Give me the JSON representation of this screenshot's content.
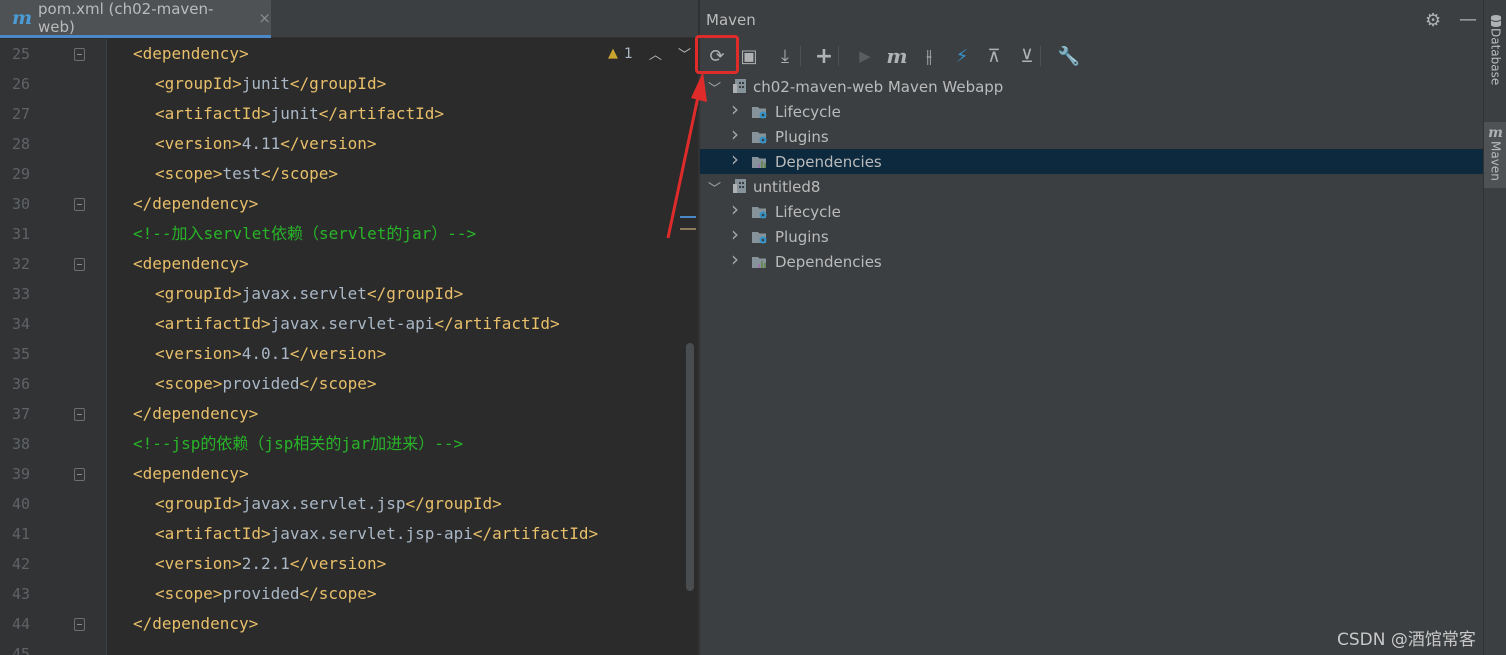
{
  "editor": {
    "tab": {
      "icon": "maven-m-icon",
      "label": "pom.xml (ch02-maven-web)",
      "close": "×"
    },
    "inspection": {
      "icon": "warning-icon",
      "count": "1"
    },
    "lines": [
      {
        "num": "25",
        "indent": 1,
        "parts": [
          {
            "c": "tag",
            "t": "<dependency>"
          }
        ],
        "fold": "start"
      },
      {
        "num": "26",
        "indent": 2,
        "parts": [
          {
            "c": "tag",
            "t": "<groupId>"
          },
          {
            "c": "txt",
            "t": "junit"
          },
          {
            "c": "tag",
            "t": "</groupId>"
          }
        ]
      },
      {
        "num": "27",
        "indent": 2,
        "parts": [
          {
            "c": "tag",
            "t": "<artifactId>"
          },
          {
            "c": "txt",
            "t": "junit"
          },
          {
            "c": "tag",
            "t": "</artifactId>"
          }
        ]
      },
      {
        "num": "28",
        "indent": 2,
        "parts": [
          {
            "c": "tag",
            "t": "<version>"
          },
          {
            "c": "txt",
            "t": "4.11"
          },
          {
            "c": "tag",
            "t": "</version>"
          }
        ]
      },
      {
        "num": "29",
        "indent": 2,
        "parts": [
          {
            "c": "tag",
            "t": "<scope>"
          },
          {
            "c": "txt",
            "t": "test"
          },
          {
            "c": "tag",
            "t": "</scope>"
          }
        ]
      },
      {
        "num": "30",
        "indent": 1,
        "parts": [
          {
            "c": "tag",
            "t": "</dependency>"
          }
        ],
        "fold": "end"
      },
      {
        "num": "31",
        "indent": 1,
        "parts": [
          {
            "c": "cmt",
            "t": "<!--加入servlet依赖（servlet的jar）-->"
          }
        ]
      },
      {
        "num": "32",
        "indent": 1,
        "parts": [
          {
            "c": "tag",
            "t": "<dependency>"
          }
        ],
        "fold": "start"
      },
      {
        "num": "33",
        "indent": 2,
        "parts": [
          {
            "c": "tag",
            "t": "<groupId>"
          },
          {
            "c": "txt",
            "t": "javax.servlet"
          },
          {
            "c": "tag",
            "t": "</groupId>"
          }
        ]
      },
      {
        "num": "34",
        "indent": 2,
        "parts": [
          {
            "c": "tag",
            "t": "<artifactId>"
          },
          {
            "c": "txt",
            "t": "javax.servlet-api"
          },
          {
            "c": "tag",
            "t": "</artifactId>"
          }
        ]
      },
      {
        "num": "35",
        "indent": 2,
        "parts": [
          {
            "c": "tag",
            "t": "<version>"
          },
          {
            "c": "txt",
            "t": "4.0.1"
          },
          {
            "c": "tag",
            "t": "</version>"
          }
        ]
      },
      {
        "num": "36",
        "indent": 2,
        "parts": [
          {
            "c": "tag",
            "t": "<scope>"
          },
          {
            "c": "txt",
            "t": "provided"
          },
          {
            "c": "tag",
            "t": "</scope>"
          }
        ]
      },
      {
        "num": "37",
        "indent": 1,
        "parts": [
          {
            "c": "tag",
            "t": "</dependency>"
          }
        ],
        "fold": "end"
      },
      {
        "num": "38",
        "indent": 1,
        "parts": [
          {
            "c": "cmt",
            "t": "<!--jsp的依赖（jsp相关的jar加进来）-->"
          }
        ]
      },
      {
        "num": "39",
        "indent": 1,
        "parts": [
          {
            "c": "tag",
            "t": "<dependency>"
          }
        ],
        "fold": "start"
      },
      {
        "num": "40",
        "indent": 2,
        "parts": [
          {
            "c": "tag",
            "t": "<groupId>"
          },
          {
            "c": "txt",
            "t": "javax.servlet.jsp"
          },
          {
            "c": "tag",
            "t": "</groupId>"
          }
        ]
      },
      {
        "num": "41",
        "indent": 2,
        "parts": [
          {
            "c": "tag",
            "t": "<artifactId>"
          },
          {
            "c": "txt",
            "t": "javax.servlet.jsp-api"
          },
          {
            "c": "tag",
            "t": "</artifactId>"
          }
        ]
      },
      {
        "num": "42",
        "indent": 2,
        "parts": [
          {
            "c": "tag",
            "t": "<version>"
          },
          {
            "c": "txt",
            "t": "2.2.1"
          },
          {
            "c": "tag",
            "t": "</version>"
          }
        ]
      },
      {
        "num": "43",
        "indent": 2,
        "parts": [
          {
            "c": "tag",
            "t": "<scope>"
          },
          {
            "c": "txt",
            "t": "provided"
          },
          {
            "c": "tag",
            "t": "</scope>"
          }
        ]
      },
      {
        "num": "44",
        "indent": 1,
        "parts": [
          {
            "c": "tag",
            "t": "</dependency>"
          }
        ],
        "fold": "end"
      },
      {
        "num": "45",
        "indent": 0,
        "parts": []
      }
    ]
  },
  "maven": {
    "title": "Maven",
    "toolbar": [
      {
        "name": "reload-all-maven-projects-icon",
        "glyph": "⟳",
        "highlighted": true
      },
      {
        "name": "generate-sources-icon",
        "glyph": "▣"
      },
      {
        "name": "download-sources-icon",
        "glyph": "⤓"
      },
      {
        "name": "add-maven-project-icon",
        "glyph": "+"
      },
      {
        "name": "run-maven-build-icon",
        "glyph": "▶"
      },
      {
        "name": "execute-maven-goal-icon",
        "glyph": "m"
      },
      {
        "name": "toggle-offline-mode-icon",
        "glyph": "⫲"
      },
      {
        "name": "skip-tests-icon",
        "glyph": "⚡"
      },
      {
        "name": "show-dependencies-icon",
        "glyph": "⊼"
      },
      {
        "name": "collapse-all-icon",
        "glyph": "⊻"
      },
      {
        "name": "maven-settings-icon",
        "glyph": "🔧"
      }
    ],
    "projects": [
      {
        "label": "ch02-maven-web Maven Webapp",
        "expanded": true,
        "children": [
          {
            "label": "Lifecycle",
            "icon": "lifecycle-folder-icon"
          },
          {
            "label": "Plugins",
            "icon": "plugins-folder-icon"
          },
          {
            "label": "Dependencies",
            "icon": "dependencies-folder-icon",
            "selected": true
          }
        ]
      },
      {
        "label": "untitled8",
        "expanded": true,
        "children": [
          {
            "label": "Lifecycle",
            "icon": "lifecycle-folder-icon"
          },
          {
            "label": "Plugins",
            "icon": "plugins-folder-icon"
          },
          {
            "label": "Dependencies",
            "icon": "dependencies-folder-icon"
          }
        ]
      }
    ]
  },
  "side_tabs": [
    {
      "label": "Database",
      "icon": "database-icon"
    },
    {
      "label": "Maven",
      "icon": "maven-m-icon"
    }
  ],
  "watermark": "CSDN @酒馆常客",
  "colors": {
    "tag": "#e8bf6a",
    "text": "#a9b7c6",
    "comment": "#28b428",
    "selection": "#0d293e",
    "annotation": "#e02b2b"
  }
}
